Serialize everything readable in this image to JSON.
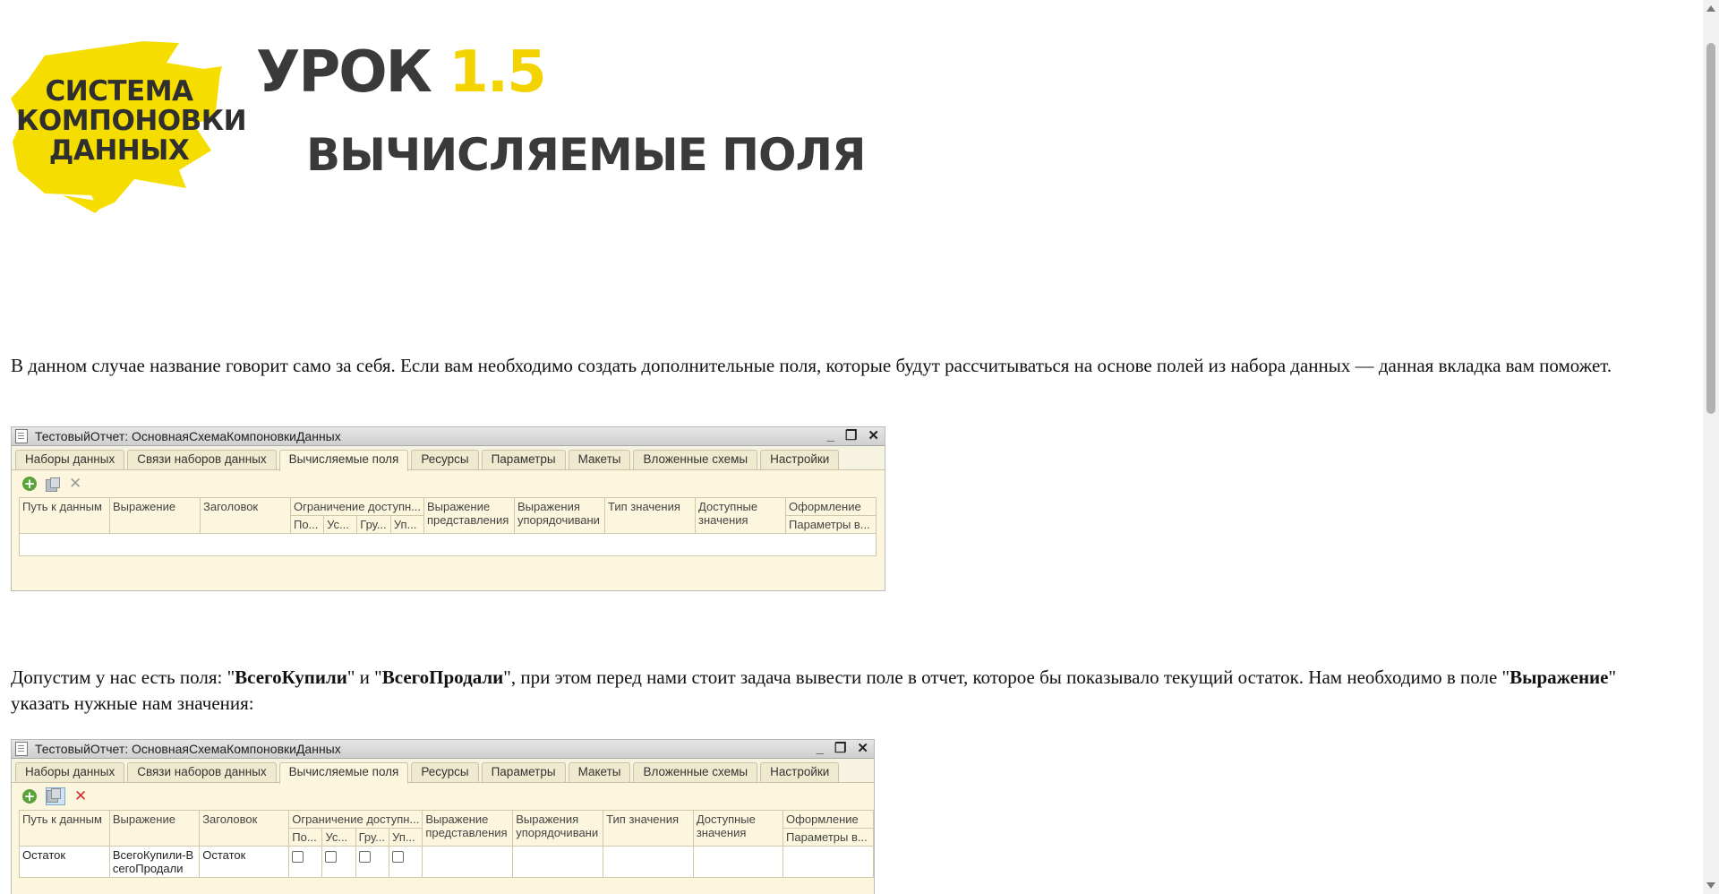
{
  "logo": {
    "lines": [
      "СИСТЕМА",
      "КОМПОНОВКИ",
      "ДАННЫХ"
    ],
    "blob_color": "#f5dd00"
  },
  "header": {
    "lesson_word": "УРОК",
    "lesson_number": "1.5",
    "subtitle": "ВЫЧИСЛЯЕМЫЕ ПОЛЯ"
  },
  "para1": "В данном случае название говорит само за себя. Если вам необходимо создать дополнительные поля, которые будут рассчитываться на основе полей из набора данных — данная вкладка вам поможет.",
  "para2": {
    "t1": "Допустим у нас есть поля: \"",
    "b1": "ВсегоКупили",
    "t2": "\" и \"",
    "b2": "ВсегоПродали",
    "t3": "\", при этом перед нами стоит задача вывести поле в отчет, которое бы показывало текущий остаток. Нам необходимо в поле \"",
    "b3": "Выражение",
    "t4": "\" указать нужные нам значения:"
  },
  "window": {
    "title": "ТестовыйОтчет: ОсновнаяСхемаКомпоновкиДанных",
    "controls": [
      "_",
      "❐",
      "✕"
    ],
    "tabs": [
      "Наборы данных",
      "Связи наборов данных",
      "Вычисляемые поля",
      "Ресурсы",
      "Параметры",
      "Макеты",
      "Вложенные схемы",
      "Настройки"
    ],
    "active_tab": "Вычисляемые поля",
    "columns": {
      "path": "Путь к данным",
      "expr": "Выражение",
      "title": "Заголовок",
      "restrict": "Ограничение доступн...",
      "restrict_sub": [
        "По...",
        "Ус...",
        "Гру...",
        "Уп..."
      ],
      "expr_repr": "Выражение представления",
      "expr_order": "Выражения упорядочивани",
      "type": "Тип значения",
      "avail": "Доступные значения",
      "design": "Оформление",
      "design_sub": "Параметры в..."
    }
  },
  "row2": {
    "path": "Остаток",
    "expr": "ВсегоКупили-ВсегоПродали",
    "title": "Остаток"
  }
}
